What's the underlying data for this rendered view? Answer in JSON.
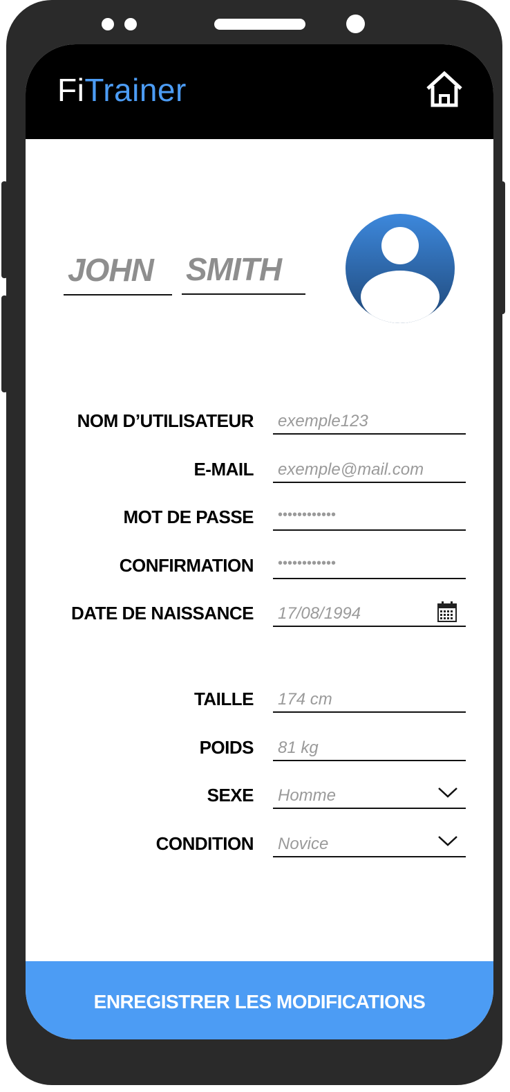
{
  "app": {
    "logo_part1": "Fi",
    "logo_part2": "Trainer",
    "home_icon": "home-icon"
  },
  "profile": {
    "first_name": "JOHN",
    "last_name": "SMITH",
    "avatar_icon": "user-avatar-icon"
  },
  "form": {
    "username": {
      "label": "NOM D’UTILISATEUR",
      "placeholder": "exemple123"
    },
    "email": {
      "label": "E-MAIL",
      "placeholder": "exemple@mail.com"
    },
    "password": {
      "label": "MOT DE PASSE",
      "value": "••••••••••••"
    },
    "confirmation": {
      "label": "CONFIRMATION",
      "value": "••••••••••••"
    },
    "birthdate": {
      "label": "DATE DE NAISSANCE",
      "placeholder": "17/08/1994",
      "icon": "calendar-icon"
    },
    "height": {
      "label": "TAILLE",
      "placeholder": "174 cm"
    },
    "weight": {
      "label": "POIDS",
      "placeholder": "81 kg"
    },
    "sex": {
      "label": "SEXE",
      "placeholder": "Homme",
      "icon": "chevron-down-icon"
    },
    "condition": {
      "label": "CONDITION",
      "placeholder": "Novice",
      "icon": "chevron-down-icon"
    }
  },
  "actions": {
    "save_label": "ENREGISTRER LES MODIFICATIONS"
  },
  "colors": {
    "accent": "#4c9cf4",
    "header_bg": "#000000",
    "frame": "#2a2a2a",
    "placeholder_text": "#9a9a9a",
    "name_text": "#8e8e8e"
  }
}
